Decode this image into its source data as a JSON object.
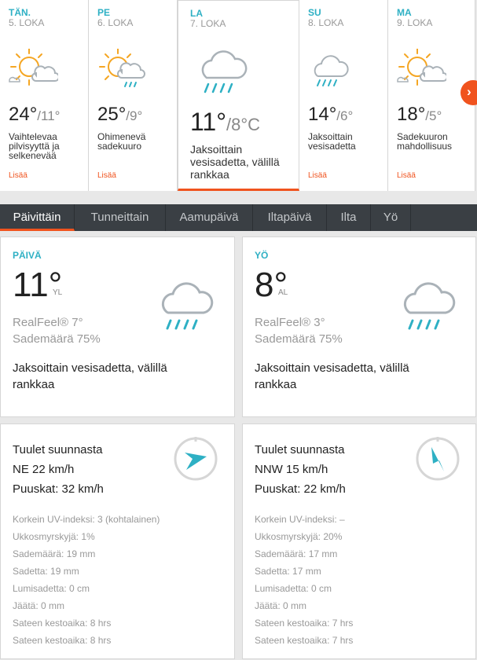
{
  "days": [
    {
      "name": "TÄN.",
      "date": "5. LOKA",
      "hi": "24°",
      "lo": "/11°",
      "desc": "Vaihtelevaa pilvisyyttä ja selkenevää",
      "more": "Lisää",
      "icon": "sun-cloud-icon"
    },
    {
      "name": "PE",
      "date": "6. LOKA",
      "hi": "25°",
      "lo": "/9°",
      "desc": "Ohimenevä sadekuuro",
      "more": "Lisää",
      "icon": "sun-cloud-rain-icon"
    },
    {
      "name": "LA",
      "date": "7. LOKA",
      "hi": "11°",
      "lo": "/8°C",
      "desc": "Jaksoittain vesisadetta, välillä rankkaa",
      "more": "",
      "icon": "cloud-rain-icon"
    },
    {
      "name": "SU",
      "date": "8. LOKA",
      "hi": "14°",
      "lo": "/6°",
      "desc": "Jaksoittain vesisadetta",
      "more": "Lisää",
      "icon": "cloud-rain-icon"
    },
    {
      "name": "MA",
      "date": "9. LOKA",
      "hi": "18°",
      "lo": "/5°",
      "desc": "Sadekuuron mahdollisuus",
      "more": "Lisää",
      "icon": "sun-cloud-icon"
    }
  ],
  "tabs": [
    "Päivittäin",
    "Tunneittain",
    "Aamupäivä",
    "Iltapäivä",
    "Ilta",
    "Yö"
  ],
  "day_panel": {
    "label": "PÄIVÄ",
    "temp": "11°",
    "suffix": "YL",
    "realfeel": "RealFeel® 7°",
    "precip": "Sademäärä 75%",
    "desc": "Jaksoittain vesisadetta, välillä rankkaa",
    "wind_title": "Tuulet suunnasta",
    "wind_dir": "NE 22 km/h",
    "gusts": "Puuskat: 32 km/h",
    "stats": [
      "Korkein UV-indeksi: 3 (kohtalainen)",
      "Ukkosmyrskyjä: 1%",
      "Sademäärä: 19 mm",
      "Sadetta: 19 mm",
      "Lumisadetta: 0 cm",
      "Jäätä: 0 mm",
      "Sateen kestoaika: 8 hrs",
      "Sateen kestoaika: 8 hrs"
    ]
  },
  "night_panel": {
    "label": "YÖ",
    "temp": "8°",
    "suffix": "AL",
    "realfeel": "RealFeel® 3°",
    "precip": "Sademäärä 75%",
    "desc": "Jaksoittain vesisadetta, välillä rankkaa",
    "wind_title": "Tuulet suunnasta",
    "wind_dir": "NNW 15 km/h",
    "gusts": "Puuskat: 22 km/h",
    "stats": [
      "Korkein UV-indeksi: –",
      "Ukkosmyrskyjä: 20%",
      "Sademäärä: 17 mm",
      "Sadetta: 17 mm",
      "Lumisadetta: 0 cm",
      "Jäätä: 0 mm",
      "Sateen kestoaika: 7 hrs",
      "Sateen kestoaika: 7 hrs"
    ]
  },
  "colors": {
    "accent": "#f0531e",
    "teal": "#2eb0c4",
    "tabbar": "#3a3f44"
  }
}
